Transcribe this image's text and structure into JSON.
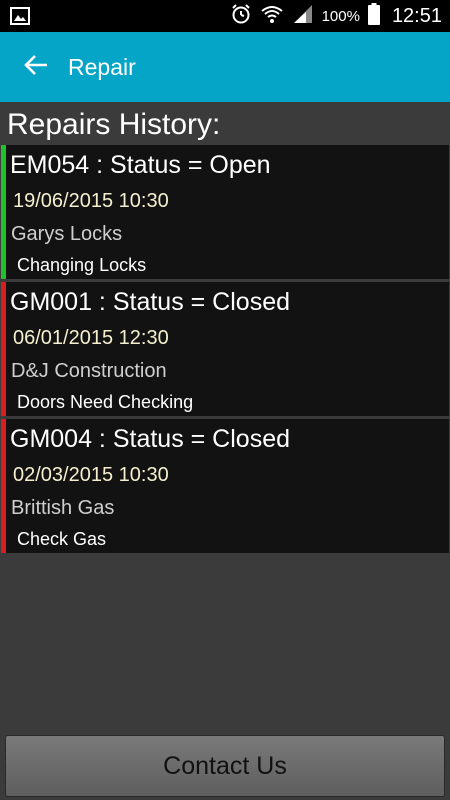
{
  "status_bar": {
    "battery_percent": "100%",
    "time": "12:51",
    "icons": [
      "image-icon",
      "alarm-icon",
      "wifi-icon",
      "signal-icon",
      "battery-icon"
    ]
  },
  "app_bar": {
    "back_icon": "arrow-left-icon",
    "title": "Repair",
    "color": "#04a5c7"
  },
  "section_title": "Repairs History:",
  "repairs": [
    {
      "code": "EM054",
      "status_label": "Status = Open",
      "heading": "EM054 :  Status = Open",
      "datetime": "19/06/2015 10:30",
      "company": "Garys Locks",
      "description": "Changing Locks",
      "status_color": "#22c02a"
    },
    {
      "code": "GM001",
      "status_label": "Status = Closed",
      "heading": "GM001 :  Status = Closed",
      "datetime": "06/01/2015 12:30",
      "company": "D&J Construction",
      "description": "Doors Need Checking",
      "status_color": "#d81e1e"
    },
    {
      "code": "GM004",
      "status_label": "Status = Closed",
      "heading": "GM004 :  Status = Closed",
      "datetime": "02/03/2015 10:30",
      "company": "Brittish Gas",
      "description": "Check Gas",
      "status_color": "#d81e1e"
    }
  ],
  "contact_button": {
    "label": "Contact Us"
  }
}
